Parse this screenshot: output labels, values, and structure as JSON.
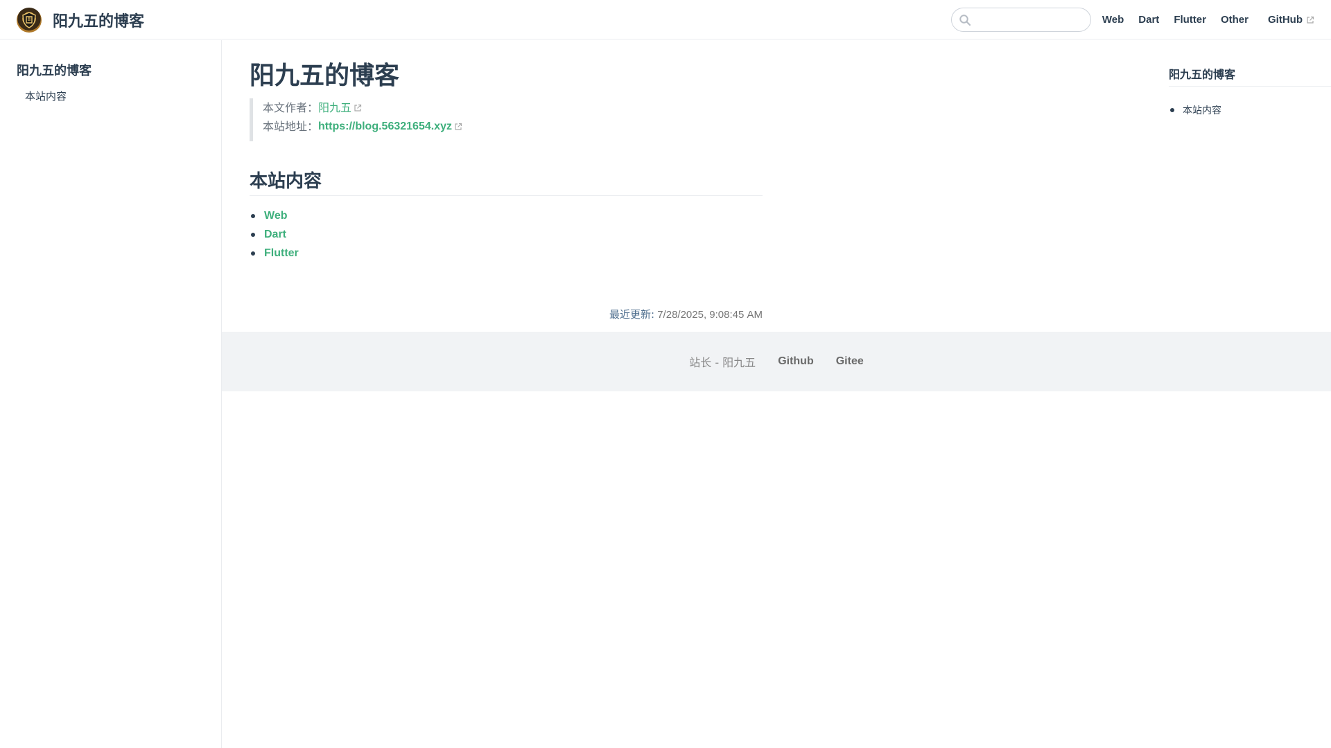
{
  "header": {
    "site_title": "阳九五的博客",
    "logo_icon": "shield-logo-icon",
    "search": {
      "value": "",
      "placeholder": ""
    },
    "nav": [
      {
        "label": "Web"
      },
      {
        "label": "Dart"
      },
      {
        "label": "Flutter"
      },
      {
        "label": "Other"
      },
      {
        "label": "GitHub",
        "external": true
      }
    ]
  },
  "sidebar": {
    "heading": "阳九五的博客",
    "items": [
      {
        "label": "本站内容"
      }
    ]
  },
  "main": {
    "title": "阳九五的博客",
    "meta": {
      "author_label": "本文作者：",
      "author_name": "阳九五",
      "site_label": "本站地址：",
      "site_url": "https://blog.56321654.xyz"
    },
    "section_heading": "本站内容",
    "links": [
      {
        "label": "Web"
      },
      {
        "label": "Dart"
      },
      {
        "label": "Flutter"
      }
    ],
    "last_updated_label": "最近更新:",
    "last_updated_value": "7/28/2025, 9:08:45 AM"
  },
  "footer": {
    "owner_text": "站长 - 阳九五",
    "links": [
      {
        "label": "Github"
      },
      {
        "label": "Gitee"
      }
    ]
  },
  "toc": {
    "title": "阳九五的博客",
    "items": [
      {
        "label": "本站内容"
      }
    ]
  },
  "colors": {
    "accent": "#3eaf7c",
    "text": "#2c3e50",
    "border": "#eaecef",
    "footer_bg": "#f1f3f5"
  }
}
